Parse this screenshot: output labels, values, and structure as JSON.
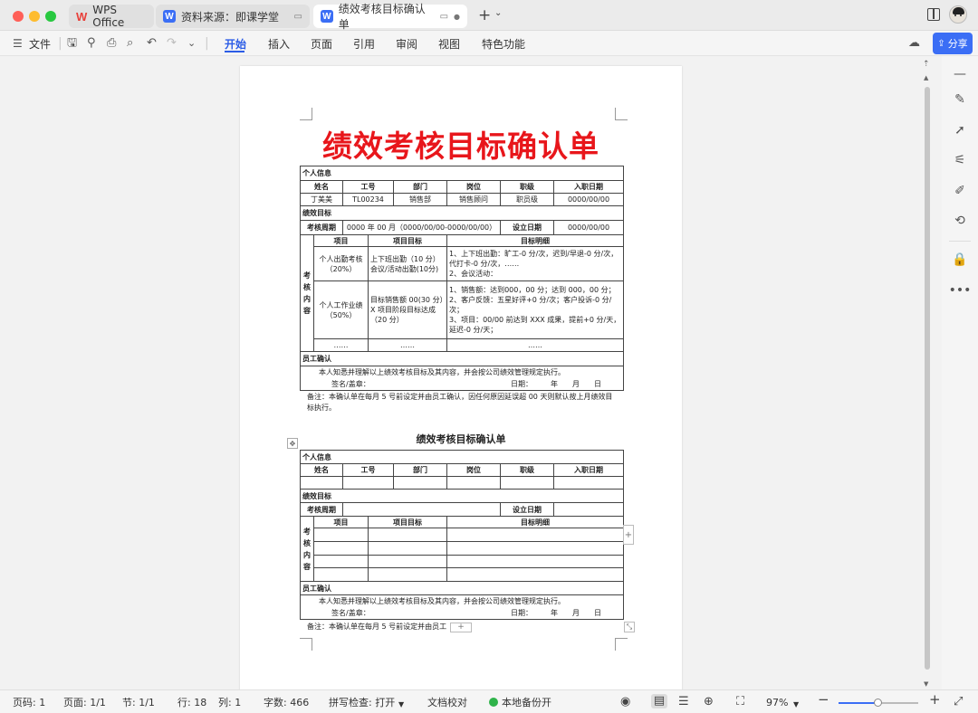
{
  "window": {
    "tabs": [
      {
        "label": "WPS Office",
        "icon": "wps-logo-icon"
      },
      {
        "label": "资料来源：即课学堂",
        "icon": "w-doc-icon"
      },
      {
        "label": "绩效考核目标确认单",
        "icon": "w-doc-icon"
      }
    ]
  },
  "toolbar": {
    "file_label": "文件",
    "menus": [
      "开始",
      "插入",
      "页面",
      "引用",
      "审阅",
      "视图",
      "特色功能"
    ],
    "active_menu": "开始",
    "share_label": "分享"
  },
  "document": {
    "title": "绩效考核目标确认单",
    "section_personal": "个人信息",
    "headers": [
      "姓名",
      "工号",
      "部门",
      "岗位",
      "职级",
      "入职日期"
    ],
    "person": [
      "丁美美",
      "TL00234",
      "销售部",
      "销售顾问",
      "职员级",
      "0000/00/00"
    ],
    "section_goal": "绩效目标",
    "period_label": "考核周期",
    "period_value": "0000 年 00 月（0000/00/00-0000/00/00）",
    "setdate_label": "设立日期",
    "setdate_value": "0000/00/00",
    "content_label": "考核内容",
    "content_chars": [
      "考",
      "核",
      "内",
      "容"
    ],
    "col_item": "项目",
    "col_target": "项目目标",
    "col_detail": "目标明细",
    "row1": {
      "item": "个人出勤考核（20%）",
      "target": "上下班出勤（10 分）会议/活动出勤(10分)",
      "detail": "1、上下班出勤：旷工-0 分/次，迟到/早退-0 分/次，代打卡-0 分/次，……\n2、会议活动："
    },
    "row2": {
      "item": "个人工作业绩（50%）",
      "target": "目标销售额 00(30 分）X 项目阶段目标达成（20 分）",
      "detail": "1、销售额：达到000，00 分；达到 000，00 分；\n2、客户反馈：五星好评+0 分/次；客户投诉-0 分/次；\n3、项目：00/00 前达到 XXX 成果，提前+0 分/天，延迟-0 分/天；"
    },
    "ellipsis": "……",
    "section_confirm": "员工确认",
    "confirm_text": "本人知悉并理解以上绩效考核目标及其内容，并会按公司绩效管理规定执行。",
    "sign_label": "签名/盖章：",
    "date_label": "日期：",
    "date_year": "年",
    "date_month": "月",
    "date_day": "日",
    "remark": "备注：本确认单在每月 5 号前设定并由员工确认，因任何原因延误超 00 天则默认按上月绩效目标执行。",
    "template_title": "绩效考核目标确认单",
    "template_remark": "备注：本确认单在每月 5 号前设定并由员工"
  },
  "statusbar": {
    "page": "页码: 1",
    "pages": "页面: 1/1",
    "section": "节: 1/1",
    "row": "行: 18",
    "col": "列: 1",
    "words": "字数: 466",
    "spell": "拼写检查: 打开",
    "proof": "文档校对",
    "backup": "本地备份开",
    "zoom": "97%",
    "zoom_level": 0.5
  },
  "colors": {
    "title_red": "#e8161b",
    "accent_blue": "#3b6ef5",
    "wps_red": "#e8403a",
    "doc_blue": "#3b6ef5",
    "backup_green": "#2fb34a"
  }
}
